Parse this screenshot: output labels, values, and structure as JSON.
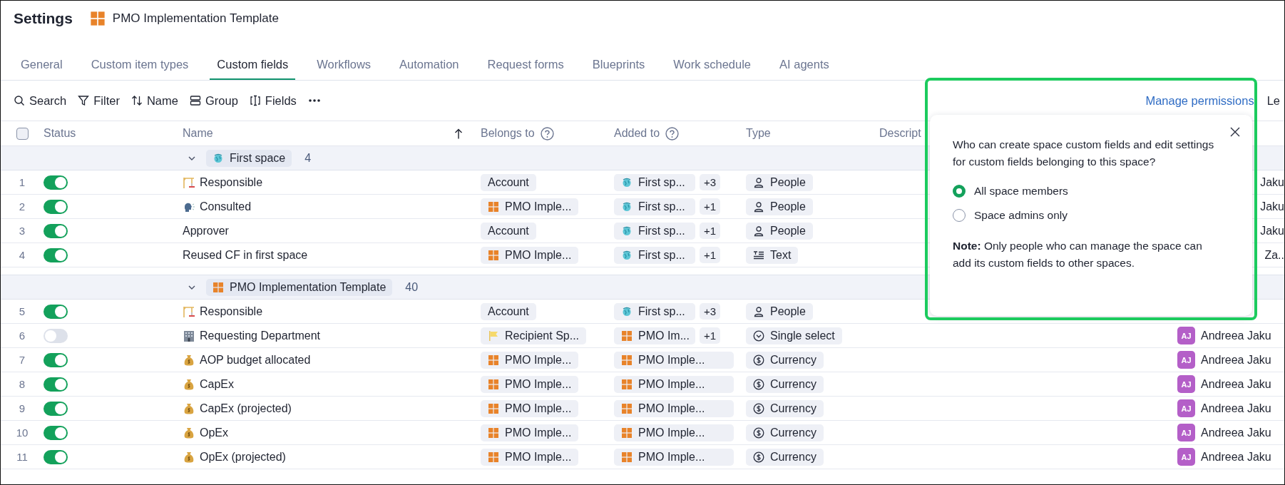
{
  "header": {
    "title": "Settings",
    "space_name": "PMO Implementation Template"
  },
  "tabs": [
    {
      "label": "General",
      "selected": false
    },
    {
      "label": "Custom item types",
      "selected": false
    },
    {
      "label": "Custom fields",
      "selected": true
    },
    {
      "label": "Workflows",
      "selected": false
    },
    {
      "label": "Automation",
      "selected": false
    },
    {
      "label": "Request forms",
      "selected": false
    },
    {
      "label": "Blueprints",
      "selected": false
    },
    {
      "label": "Work schedule",
      "selected": false
    },
    {
      "label": "AI agents",
      "selected": false
    }
  ],
  "toolbar": {
    "items": [
      {
        "kind": "search",
        "label": "Search"
      },
      {
        "kind": "filter",
        "label": "Filter"
      },
      {
        "kind": "sort",
        "label": "Name"
      },
      {
        "kind": "group",
        "label": "Group"
      },
      {
        "kind": "fields",
        "label": "Fields"
      },
      {
        "kind": "more"
      }
    ],
    "permissions_link": "Manage permissions",
    "cut_button": "Le"
  },
  "table": {
    "select_all_checked": false,
    "columns": [
      {
        "kind": "status",
        "label": "Status"
      },
      {
        "kind": "name",
        "label": "Name",
        "sorted": true
      },
      {
        "kind": "belongs",
        "label": "Belongs to",
        "help": true
      },
      {
        "kind": "added",
        "label": "Added to",
        "help": true
      },
      {
        "kind": "type",
        "label": "Type"
      },
      {
        "kind": "description",
        "label": "Descript"
      }
    ],
    "groups": [
      {
        "kind": "globe",
        "name": "First space",
        "count": "4",
        "expanded": true,
        "rows": [
          {
            "number": "1",
            "enabled": true,
            "field": {
              "kind": "crane",
              "label": "Responsible"
            },
            "belongs_to": {
              "kind": "plain",
              "label": "Account"
            },
            "added_to": {
              "kind": "globe",
              "label": "First sp..."
            },
            "extra": "+3",
            "type": {
              "kind": "person",
              "label": "People"
            },
            "owner": {
              "name": "Jaku"
            }
          },
          {
            "number": "2",
            "enabled": true,
            "field": {
              "kind": "speaker",
              "label": "Consulted"
            },
            "belongs_to": {
              "kind": "grid",
              "label": "PMO Imple..."
            },
            "added_to": {
              "kind": "globe",
              "label": "First sp..."
            },
            "extra": "+1",
            "type": {
              "kind": "person",
              "label": "People"
            },
            "owner": {
              "name": "Jaku"
            }
          },
          {
            "number": "3",
            "enabled": true,
            "field": {
              "kind": "plain",
              "label": "Approver"
            },
            "belongs_to": {
              "kind": "plain",
              "label": "Account"
            },
            "added_to": {
              "kind": "globe",
              "label": "First sp..."
            },
            "extra": "+1",
            "type": {
              "kind": "person",
              "label": "People"
            },
            "owner": {
              "name": "Jaku"
            }
          },
          {
            "number": "4",
            "enabled": true,
            "field": {
              "kind": "plain",
              "label": "Reused CF in first space"
            },
            "belongs_to": {
              "kind": "grid",
              "label": "PMO Imple..."
            },
            "added_to": {
              "kind": "globe",
              "label": "First sp..."
            },
            "extra": "+1",
            "type": {
              "kind": "text",
              "label": "Text"
            },
            "owner": {
              "name": "Za.."
            }
          }
        ]
      },
      {
        "kind": "grid",
        "name": "PMO Implementation Template",
        "count": "40",
        "expanded": true,
        "rows": [
          {
            "number": "5",
            "enabled": true,
            "field": {
              "kind": "crane",
              "label": "Responsible"
            },
            "belongs_to": {
              "kind": "plain",
              "label": "Account"
            },
            "added_to": {
              "kind": "globe",
              "label": "First sp..."
            },
            "extra": "+3",
            "type": {
              "kind": "person",
              "label": "People"
            }
          },
          {
            "number": "6",
            "enabled": false,
            "field": {
              "kind": "building",
              "label": "Requesting Department"
            },
            "belongs_to": {
              "kind": "flag",
              "label": "Recipient Sp..."
            },
            "added_to": {
              "kind": "grid",
              "label": "PMO Im..."
            },
            "extra": "+1",
            "type": {
              "kind": "select",
              "label": "Single select"
            },
            "owner": {
              "initials": "AJ",
              "name": "Andreea Jaku"
            }
          },
          {
            "number": "7",
            "enabled": true,
            "field": {
              "kind": "moneybag",
              "label": "AOP budget allocated"
            },
            "belongs_to": {
              "kind": "grid",
              "label": "PMO Imple..."
            },
            "added_to": {
              "kind": "grid",
              "label": "PMO Imple..."
            },
            "type": {
              "kind": "currency",
              "label": "Currency"
            },
            "owner": {
              "initials": "AJ",
              "name": "Andreea Jaku"
            }
          },
          {
            "number": "8",
            "enabled": true,
            "field": {
              "kind": "moneybag",
              "label": "CapEx"
            },
            "belongs_to": {
              "kind": "grid",
              "label": "PMO Imple..."
            },
            "added_to": {
              "kind": "grid",
              "label": "PMO Imple..."
            },
            "type": {
              "kind": "currency",
              "label": "Currency"
            },
            "owner": {
              "initials": "AJ",
              "name": "Andreea Jaku"
            }
          },
          {
            "number": "9",
            "enabled": true,
            "field": {
              "kind": "moneybag",
              "label": "CapEx (projected)"
            },
            "belongs_to": {
              "kind": "grid",
              "label": "PMO Imple..."
            },
            "added_to": {
              "kind": "grid",
              "label": "PMO Imple..."
            },
            "type": {
              "kind": "currency",
              "label": "Currency"
            },
            "owner": {
              "initials": "AJ",
              "name": "Andreea Jaku"
            }
          },
          {
            "number": "10",
            "enabled": true,
            "field": {
              "kind": "moneybag",
              "label": "OpEx"
            },
            "belongs_to": {
              "kind": "grid",
              "label": "PMO Imple..."
            },
            "added_to": {
              "kind": "grid",
              "label": "PMO Imple..."
            },
            "type": {
              "kind": "currency",
              "label": "Currency"
            },
            "owner": {
              "initials": "AJ",
              "name": "Andreea Jaku"
            }
          },
          {
            "number": "11",
            "enabled": true,
            "field": {
              "kind": "moneybag",
              "label": "OpEx (projected)"
            },
            "belongs_to": {
              "kind": "grid",
              "label": "PMO Imple..."
            },
            "added_to": {
              "kind": "grid",
              "label": "PMO Imple..."
            },
            "type": {
              "kind": "currency",
              "label": "Currency"
            },
            "owner": {
              "initials": "AJ",
              "name": "Andreea Jaku"
            }
          }
        ]
      }
    ]
  },
  "popover": {
    "question": "Who can create space custom fields and edit settings for custom fields belonging to this space?",
    "options": [
      {
        "label": "All space members",
        "selected": true
      },
      {
        "label": "Space admins only",
        "selected": false
      }
    ],
    "note": "**Note:** Only people who can manage the space can add its custom fields to other spaces.",
    "highlighted": true
  }
}
